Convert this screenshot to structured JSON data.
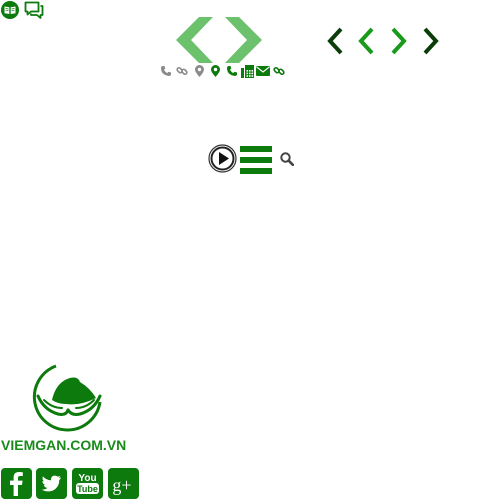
{
  "colors": {
    "brand_green": "#0c7a0c",
    "light_green": "#6cc26c",
    "dark_green": "#0b4d0b",
    "gray_icon": "#8a8a8a"
  },
  "top_left_icons": [
    {
      "icon": "book-circle-icon"
    },
    {
      "icon": "chat-bubbles-icon"
    }
  ],
  "nav_arrows_large": [
    {
      "icon": "chevron-left-icon"
    },
    {
      "icon": "chevron-right-icon"
    }
  ],
  "nav_arrows_small": [
    {
      "icon": "chevron-left-icon"
    },
    {
      "icon": "chevron-left-icon"
    },
    {
      "icon": "chevron-right-icon"
    },
    {
      "icon": "chevron-right-icon"
    }
  ],
  "contact_icons": [
    "phone-icon",
    "link-icon",
    "map-marker-icon",
    "map-marker-icon",
    "phone-icon",
    "fax-icon",
    "envelope-icon",
    "link-icon"
  ],
  "toolbar": {
    "play_icon": "play-circle-icon",
    "menu_icon": "hamburger-menu-icon",
    "search_icon": "search-icon"
  },
  "brand": {
    "logo_icon": "viemgan-logo",
    "name": "VIEMGAN.COM.VN"
  },
  "social": [
    {
      "name": "facebook",
      "icon": "facebook-icon"
    },
    {
      "name": "twitter",
      "icon": "twitter-icon"
    },
    {
      "name": "youtube",
      "icon": "youtube-icon",
      "label_top": "You",
      "label_bottom": "Tube"
    },
    {
      "name": "google-plus",
      "icon": "google-plus-icon",
      "label": "g+"
    }
  ]
}
